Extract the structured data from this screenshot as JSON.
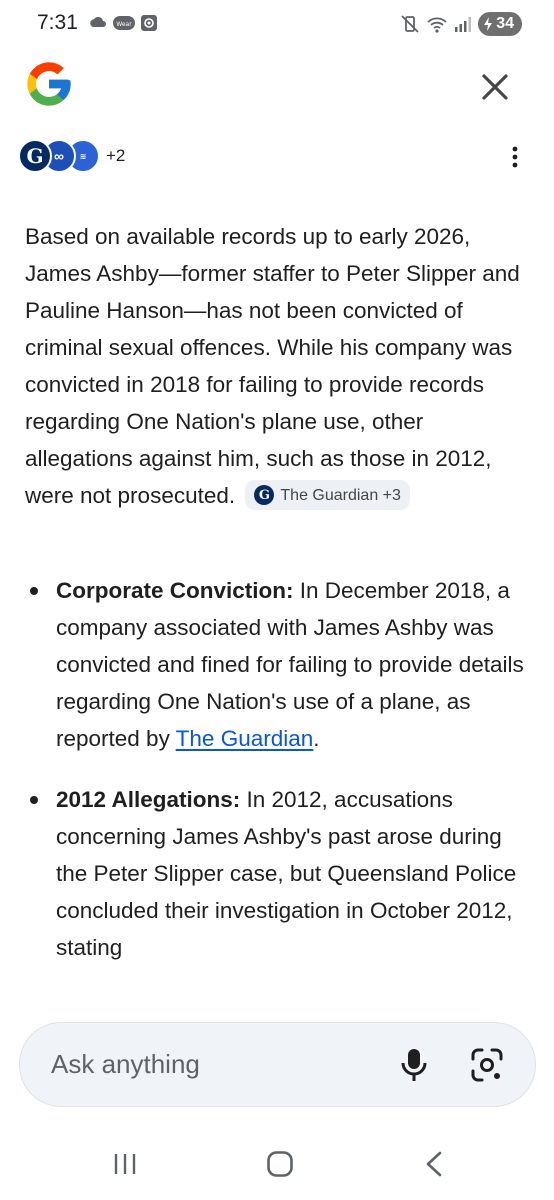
{
  "status_bar": {
    "time": "7:31",
    "battery": "34",
    "left_icons": [
      "weather-icon",
      "wear-app-icon",
      "screen-record-icon"
    ],
    "right_icons": [
      "mute-vibrate-icon",
      "wifi-icon",
      "signal-icon",
      "battery-charging-icon"
    ]
  },
  "header": {
    "logo": "google-logo",
    "sources_more": "+2"
  },
  "answer": {
    "paragraph": "Based on available records up to early 2026, James Ashby—former staffer to Peter Slipper and Pauline Hanson—has not been convicted of criminal sexual offences. While his company was convicted in 2018 for failing to provide records regarding One Nation's plane use, other allegations against him, such as those in 2012, were not prosecuted.",
    "citation_chip": "The Guardian +3",
    "bullets": [
      {
        "title": "Corporate Conviction:",
        "text": " In December 2018, a company associated with James Ashby was convicted and fined for failing to provide details regarding One Nation's use of a plane, as reported by ",
        "link": "The Guardian",
        "tail": "."
      },
      {
        "title": "2012 Allegations:",
        "text": " In 2012, accusations concerning James Ashby's past arose during the Peter Slipper case, but Queensland Police concluded their investigation in October 2012, stating"
      }
    ]
  },
  "ask_bar": {
    "placeholder": "Ask anything"
  },
  "colors": {
    "link": "#0b57d0",
    "ask_bar_bg": "#f0f3f8",
    "chip_bg": "#edf0f4",
    "guardian_blue": "#052962"
  }
}
